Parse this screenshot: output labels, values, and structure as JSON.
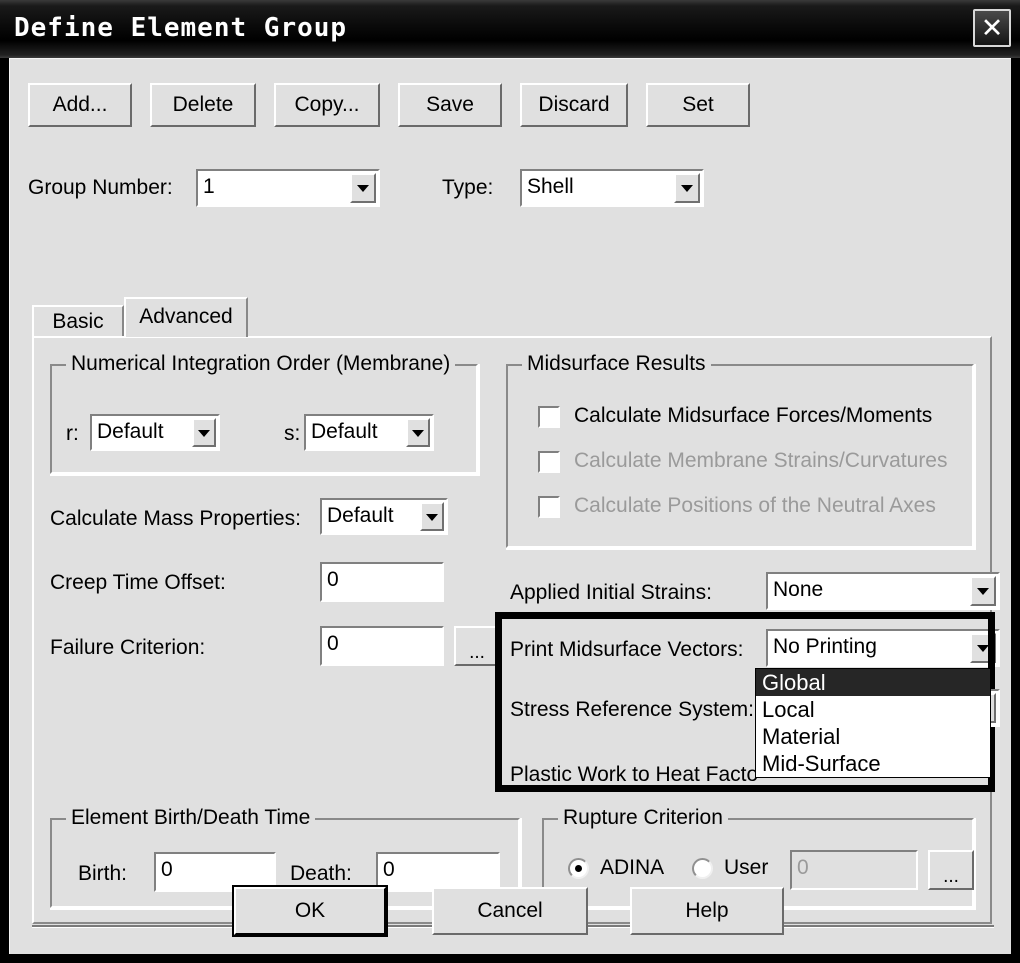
{
  "window": {
    "title": "Define Element Group",
    "close_icon": "close-icon",
    "close_label": "✕"
  },
  "toolbar": {
    "buttons": [
      {
        "label": "Add...",
        "name": "add-button"
      },
      {
        "label": "Delete",
        "name": "delete-button"
      },
      {
        "label": "Copy...",
        "name": "copy-button"
      },
      {
        "label": "Save",
        "name": "save-button"
      },
      {
        "label": "Discard",
        "name": "discard-button"
      },
      {
        "label": "Set",
        "name": "set-button"
      }
    ]
  },
  "header": {
    "group_number_label": "Group Number:",
    "group_number_value": "1",
    "type_label": "Type:",
    "type_value": "Shell"
  },
  "tabs": [
    {
      "label": "Basic",
      "selected": false
    },
    {
      "label": "Advanced",
      "selected": true
    }
  ],
  "integration": {
    "title": "Numerical Integration Order (Membrane)",
    "r_label": "r:",
    "r_value": "Default",
    "s_label": "s:",
    "s_value": "Default"
  },
  "left_fields": {
    "mass_label": "Calculate Mass Properties:",
    "mass_value": "Default",
    "creep_label": "Creep Time Offset:",
    "creep_value": "0",
    "failure_label": "Failure Criterion:",
    "failure_value": "0",
    "failure_browse_label": "..."
  },
  "midsurface": {
    "title": "Midsurface Results",
    "checkboxes": [
      {
        "label": "Calculate Midsurface Forces/Moments",
        "checked": false,
        "enabled": true
      },
      {
        "label": "Calculate Membrane Strains/Curvatures",
        "checked": false,
        "enabled": false
      },
      {
        "label": "Calculate Positions of the Neutral Axes",
        "checked": false,
        "enabled": false
      }
    ]
  },
  "right_fields": {
    "initial_strains_label": "Applied Initial Strains:",
    "initial_strains_value": "None",
    "print_vectors_label": "Print Midsurface Vectors:",
    "print_vectors_value": "No Printing",
    "stress_ref_label": "Stress Reference System:",
    "stress_ref_value": "Global",
    "plastic_work_label": "Plastic Work to Heat Facto"
  },
  "stress_ref_dropdown": {
    "open": true,
    "options": [
      {
        "label": "Global",
        "selected": true
      },
      {
        "label": "Local",
        "selected": false
      },
      {
        "label": "Material",
        "selected": false
      },
      {
        "label": "Mid-Surface",
        "selected": false
      }
    ]
  },
  "birth_death": {
    "title": "Element Birth/Death Time",
    "birth_label": "Birth:",
    "birth_value": "0",
    "death_label": "Death:",
    "death_value": "0"
  },
  "rupture": {
    "title": "Rupture Criterion",
    "adina_label": "ADINA",
    "user_label": "User",
    "selected": "ADINA",
    "value": "0",
    "browse_label": "..."
  },
  "footer": {
    "ok_label": "OK",
    "cancel_label": "Cancel",
    "help_label": "Help"
  },
  "colors": {
    "dialog_bg": "#e0e0e0",
    "titlebar": "#0a0a0a",
    "highlight_border": "#000000",
    "dropdown_selected_bg": "#262626",
    "disabled_text": "#9a9a9a"
  }
}
